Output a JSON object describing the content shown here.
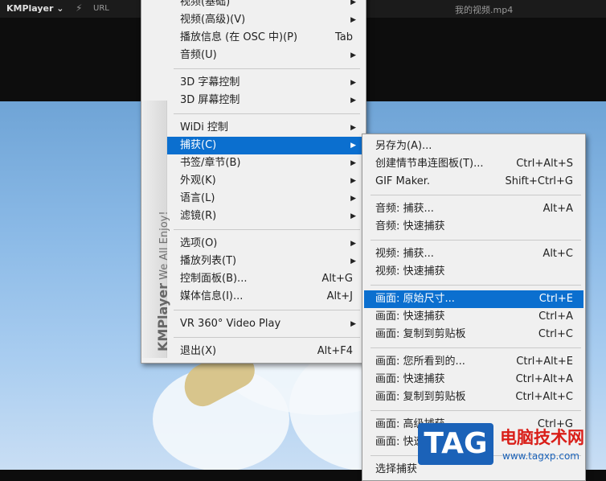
{
  "titlebar": {
    "logo": "KMPlayer ⌄",
    "bolt": "⚡",
    "url_label": "URL",
    "file_title": "我的视频.mp4"
  },
  "menu1": {
    "items": [
      {
        "label": "视频(基础)",
        "shortcut": "",
        "arrow": "▶"
      },
      {
        "label": "视频(高级)(V)",
        "shortcut": "",
        "arrow": "▶"
      },
      {
        "label": "播放信息 (在 OSC 中)(P)",
        "shortcut": "Tab",
        "arrow": ""
      },
      {
        "label": "音频(U)",
        "shortcut": "",
        "arrow": "▶"
      },
      {
        "label": "3D 字幕控制",
        "shortcut": "",
        "arrow": "▶"
      },
      {
        "label": "3D 屏幕控制",
        "shortcut": "",
        "arrow": "▶"
      },
      {
        "label": "WiDi 控制",
        "shortcut": "",
        "arrow": "▶"
      },
      {
        "label": "捕获(C)",
        "shortcut": "",
        "arrow": "▶"
      },
      {
        "label": "书签/章节(B)",
        "shortcut": "",
        "arrow": "▶"
      },
      {
        "label": "外观(K)",
        "shortcut": "",
        "arrow": "▶"
      },
      {
        "label": "语言(L)",
        "shortcut": "",
        "arrow": "▶"
      },
      {
        "label": "滤镜(R)",
        "shortcut": "",
        "arrow": "▶"
      },
      {
        "label": "选项(O)",
        "shortcut": "",
        "arrow": "▶"
      },
      {
        "label": "播放列表(T)",
        "shortcut": "",
        "arrow": "▶"
      },
      {
        "label": "控制面板(B)...",
        "shortcut": "Alt+G",
        "arrow": ""
      },
      {
        "label": "媒体信息(I)...",
        "shortcut": "Alt+J",
        "arrow": ""
      },
      {
        "label": "VR 360° Video Play",
        "shortcut": "",
        "arrow": "▶"
      },
      {
        "label": "退出(X)",
        "shortcut": "Alt+F4",
        "arrow": ""
      }
    ],
    "sidebar_brand": "KMPlayer",
    "sidebar_slogan": "We All Enjoy!"
  },
  "menu2": {
    "items": [
      {
        "label": "另存为(A)...",
        "shortcut": ""
      },
      {
        "label": "创建情节串连图板(T)...",
        "shortcut": "Ctrl+Alt+S"
      },
      {
        "label": "GIF Maker.",
        "shortcut": "Shift+Ctrl+G"
      },
      {
        "label": "音频: 捕获...",
        "shortcut": "Alt+A"
      },
      {
        "label": "音频: 快速捕获",
        "shortcut": ""
      },
      {
        "label": "视频: 捕获...",
        "shortcut": "Alt+C"
      },
      {
        "label": "视频: 快速捕获",
        "shortcut": ""
      },
      {
        "label": "画面: 原始尺寸...",
        "shortcut": "Ctrl+E"
      },
      {
        "label": "画面: 快速捕获",
        "shortcut": "Ctrl+A"
      },
      {
        "label": "画面: 复制到剪贴板",
        "shortcut": "Ctrl+C"
      },
      {
        "label": "画面: 您所看到的...",
        "shortcut": "Ctrl+Alt+E"
      },
      {
        "label": "画面: 快速捕获",
        "shortcut": "Ctrl+Alt+A"
      },
      {
        "label": "画面: 复制到剪贴板",
        "shortcut": "Ctrl+Alt+C"
      },
      {
        "label": "画面: 高级捕获",
        "shortcut": "Ctrl+G"
      },
      {
        "label": "画面: 快速",
        "shortcut": ""
      },
      {
        "label": "选择捕获",
        "shortcut": ""
      }
    ]
  },
  "watermark": {
    "badge": "TAG",
    "title": "电脑技术网",
    "url": "www.tagxp.com"
  },
  "colors": {
    "highlight": "#0b6fcf",
    "menu_bg": "#f0f0f0"
  }
}
